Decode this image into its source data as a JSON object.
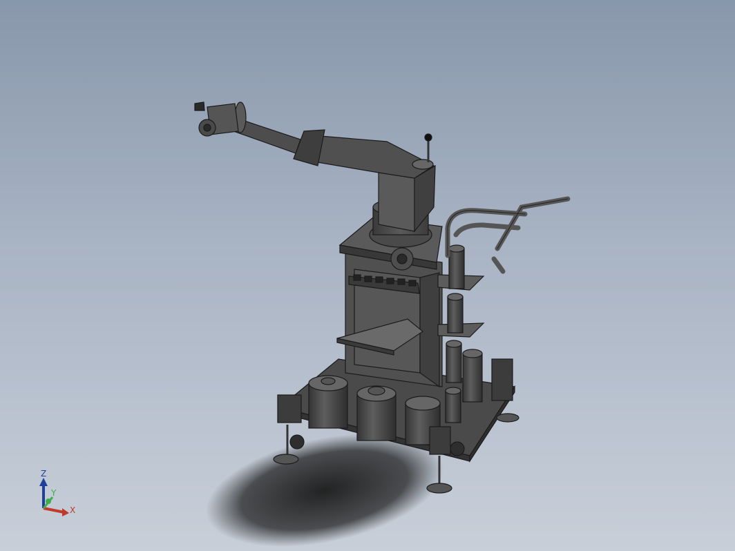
{
  "view": {
    "background_top": "#8897ab",
    "background_bottom": "#c8cfd9",
    "model_color": "#4b4b4b"
  },
  "triad": {
    "x_label": "X",
    "y_label": "Y",
    "z_label": "Z",
    "x_color": "#c0392b",
    "y_color": "#3fae49",
    "z_color": "#1f3f9a"
  }
}
